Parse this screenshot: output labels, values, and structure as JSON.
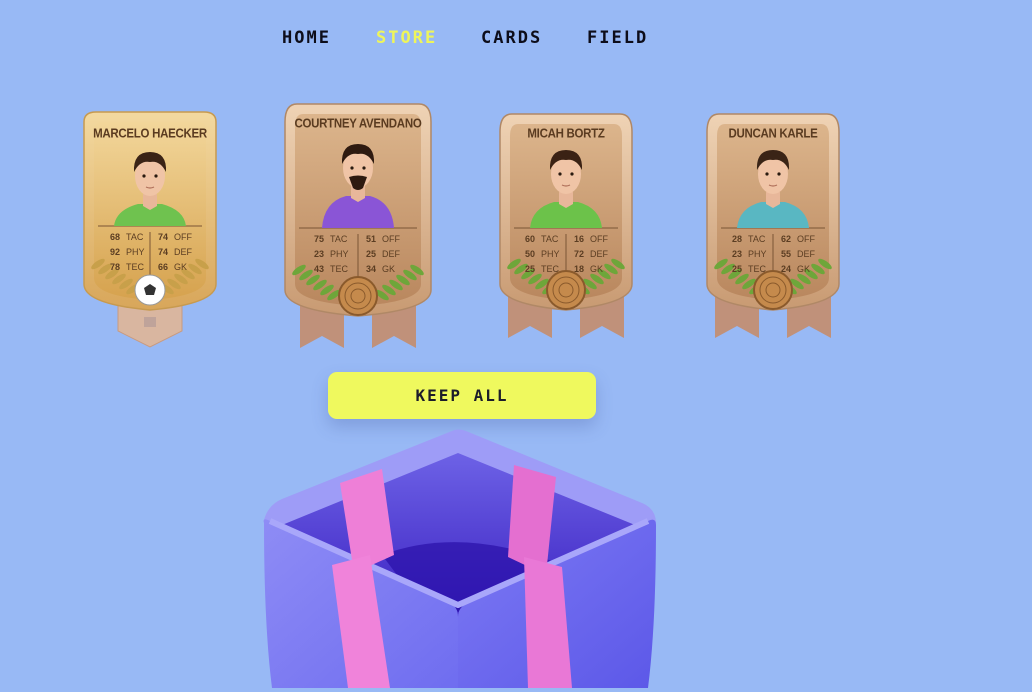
{
  "nav": {
    "items": [
      {
        "label": "HOME",
        "active": false
      },
      {
        "label": "STORE",
        "active": true
      },
      {
        "label": "CARDS",
        "active": false
      },
      {
        "label": "FIELD",
        "active": false
      }
    ]
  },
  "cards": [
    {
      "name": "MARCELO HAECKER",
      "tier": "gold",
      "shirt": "#6fc24f",
      "hair": "#3a2316",
      "stats": [
        [
          "68",
          "TAC",
          "74",
          "OFF"
        ],
        [
          "92",
          "PHY",
          "74",
          "DEF"
        ],
        [
          "78",
          "TEC",
          "66",
          "GK"
        ]
      ]
    },
    {
      "name": "COURTNEY AVENDANO",
      "tier": "wood",
      "shirt": "#8a55d6",
      "hair": "#2e1a10",
      "stats": [
        [
          "75",
          "TAC",
          "51",
          "OFF"
        ],
        [
          "23",
          "PHY",
          "25",
          "DEF"
        ],
        [
          "43",
          "TEC",
          "34",
          "GK"
        ]
      ]
    },
    {
      "name": "MICAH BORTZ",
      "tier": "wood",
      "shirt": "#6cc24a",
      "hair": "#3b2214",
      "stats": [
        [
          "60",
          "TAC",
          "16",
          "OFF"
        ],
        [
          "50",
          "PHY",
          "72",
          "DEF"
        ],
        [
          "25",
          "TEC",
          "18",
          "GK"
        ]
      ]
    },
    {
      "name": "DUNCAN KARLE",
      "tier": "wood",
      "shirt": "#59b7c2",
      "hair": "#3a2416",
      "stats": [
        [
          "28",
          "TAC",
          "62",
          "OFF"
        ],
        [
          "23",
          "PHY",
          "55",
          "DEF"
        ],
        [
          "25",
          "TEC",
          "24",
          "GK"
        ]
      ]
    }
  ],
  "actions": {
    "keep_all_label": "KEEP ALL"
  },
  "colors": {
    "background": "#98b9f5",
    "accent": "#eff95e",
    "nav_active": "#eef55a"
  }
}
